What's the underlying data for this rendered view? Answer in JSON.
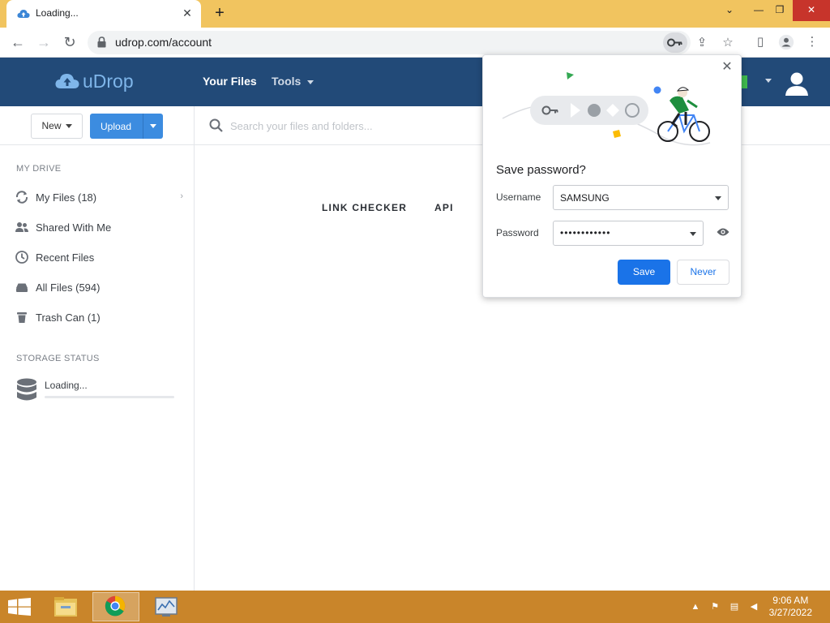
{
  "browser": {
    "tab_title": "Loading...",
    "url": "udrop.com/account",
    "window_minimize": "⌄",
    "window_restore": "—"
  },
  "site": {
    "logo_text": "uDrop",
    "nav": {
      "your_files": "Your Files",
      "tools": "Tools"
    }
  },
  "actions": {
    "new_label": "New",
    "upload_label": "Upload",
    "search_placeholder": "Search your files and folders..."
  },
  "sidebar": {
    "my_drive_heading": "MY DRIVE",
    "items": [
      {
        "label": "My Files (18)",
        "icon": "sync-icon"
      },
      {
        "label": "Shared With Me",
        "icon": "users-icon"
      },
      {
        "label": "Recent Files",
        "icon": "clock-icon"
      },
      {
        "label": "All Files (594)",
        "icon": "drive-icon"
      },
      {
        "label": "Trash Can (1)",
        "icon": "trash-icon"
      }
    ],
    "storage_heading": "STORAGE STATUS",
    "storage_text": "Loading..."
  },
  "main": {
    "links": [
      "LINK CHECKER",
      "API"
    ]
  },
  "password_popup": {
    "title": "Save password?",
    "username_label": "Username",
    "username_value": "SAMSUNG",
    "password_label": "Password",
    "password_value": "••••••••••••",
    "save_label": "Save",
    "never_label": "Never"
  },
  "taskbar": {
    "time": "9:06 AM",
    "date": "3/27/2022"
  },
  "colors": {
    "tabstrip": "#f1c45f",
    "site_header": "#224a78",
    "logo": "#7fb6ea",
    "upload_button": "#3c8ce0",
    "save_button": "#1a73e8",
    "taskbar": "#c9852a"
  }
}
